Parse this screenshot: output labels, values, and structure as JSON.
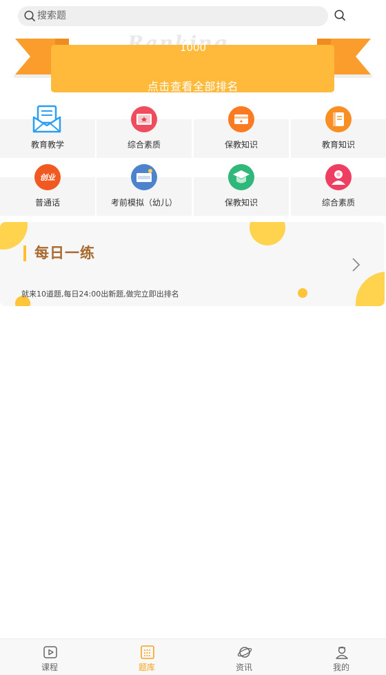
{
  "search": {
    "placeholder": "搜索题"
  },
  "ranking": {
    "watermark": "Ranking",
    "score": "1000",
    "link_label": "点击查看全部排名"
  },
  "categories": [
    {
      "label": "教育教学",
      "icon": "envelope-doc-icon",
      "color": "#2b9ef1"
    },
    {
      "label": "综合素质",
      "icon": "certificate-icon",
      "color": "#ef4d5d"
    },
    {
      "label": "保教知识",
      "icon": "card-icon",
      "color": "#fb7b22"
    },
    {
      "label": "教育知识",
      "icon": "book-icon",
      "color": "#f98e22"
    },
    {
      "label": "普通话",
      "icon": "speech-badge-icon",
      "color": "#f05a22",
      "badge_text": "创业"
    },
    {
      "label": "考前模拟（幼儿）",
      "icon": "simulation-icon",
      "color": "#4c83cc"
    },
    {
      "label": "保教知识",
      "icon": "graduation-cap-icon",
      "color": "#2fb879"
    },
    {
      "label": "综合素质",
      "icon": "person-icon",
      "color": "#ee3f63"
    }
  ],
  "daily": {
    "title": "每日一练",
    "description": "就来10道题,每日24:00出新题,做完立即出排名",
    "accent": "#ffbf2f"
  },
  "bottom_nav": [
    {
      "label": "课程",
      "icon": "play-video-icon",
      "active": false
    },
    {
      "label": "题库",
      "icon": "question-bank-icon",
      "active": true
    },
    {
      "label": "资讯",
      "icon": "planet-icon",
      "active": false
    },
    {
      "label": "我的",
      "icon": "user-profile-icon",
      "active": false
    }
  ],
  "colors": {
    "accent": "#ffba3b",
    "active_tab": "#f5a31b"
  }
}
